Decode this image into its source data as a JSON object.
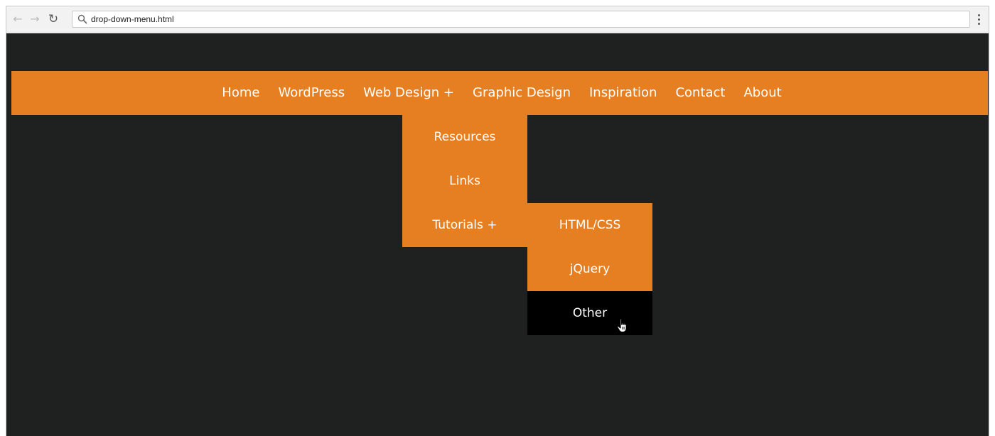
{
  "browser": {
    "address": "drop-down-menu.html",
    "icons": {
      "back": "arrow-left-icon",
      "forward": "arrow-right-icon",
      "reload": "reload-icon",
      "search": "search-icon",
      "menu": "kebab-menu-icon"
    }
  },
  "nav": {
    "items": [
      {
        "label": "Home"
      },
      {
        "label": "WordPress"
      },
      {
        "label": "Web Design +"
      },
      {
        "label": "Graphic Design"
      },
      {
        "label": "Inspiration"
      },
      {
        "label": "Contact"
      },
      {
        "label": "About"
      }
    ]
  },
  "dropdown": {
    "items": [
      {
        "label": "Resources"
      },
      {
        "label": "Links"
      },
      {
        "label": "Tutorials +"
      }
    ]
  },
  "submenu": {
    "items": [
      {
        "label": "HTML/CSS"
      },
      {
        "label": "jQuery"
      },
      {
        "label": "Other",
        "hovered": true
      }
    ]
  },
  "colors": {
    "menu_orange": "#e67e22",
    "page_background": "#1e2120",
    "hover_background": "#000000",
    "text": "#ffffff"
  }
}
